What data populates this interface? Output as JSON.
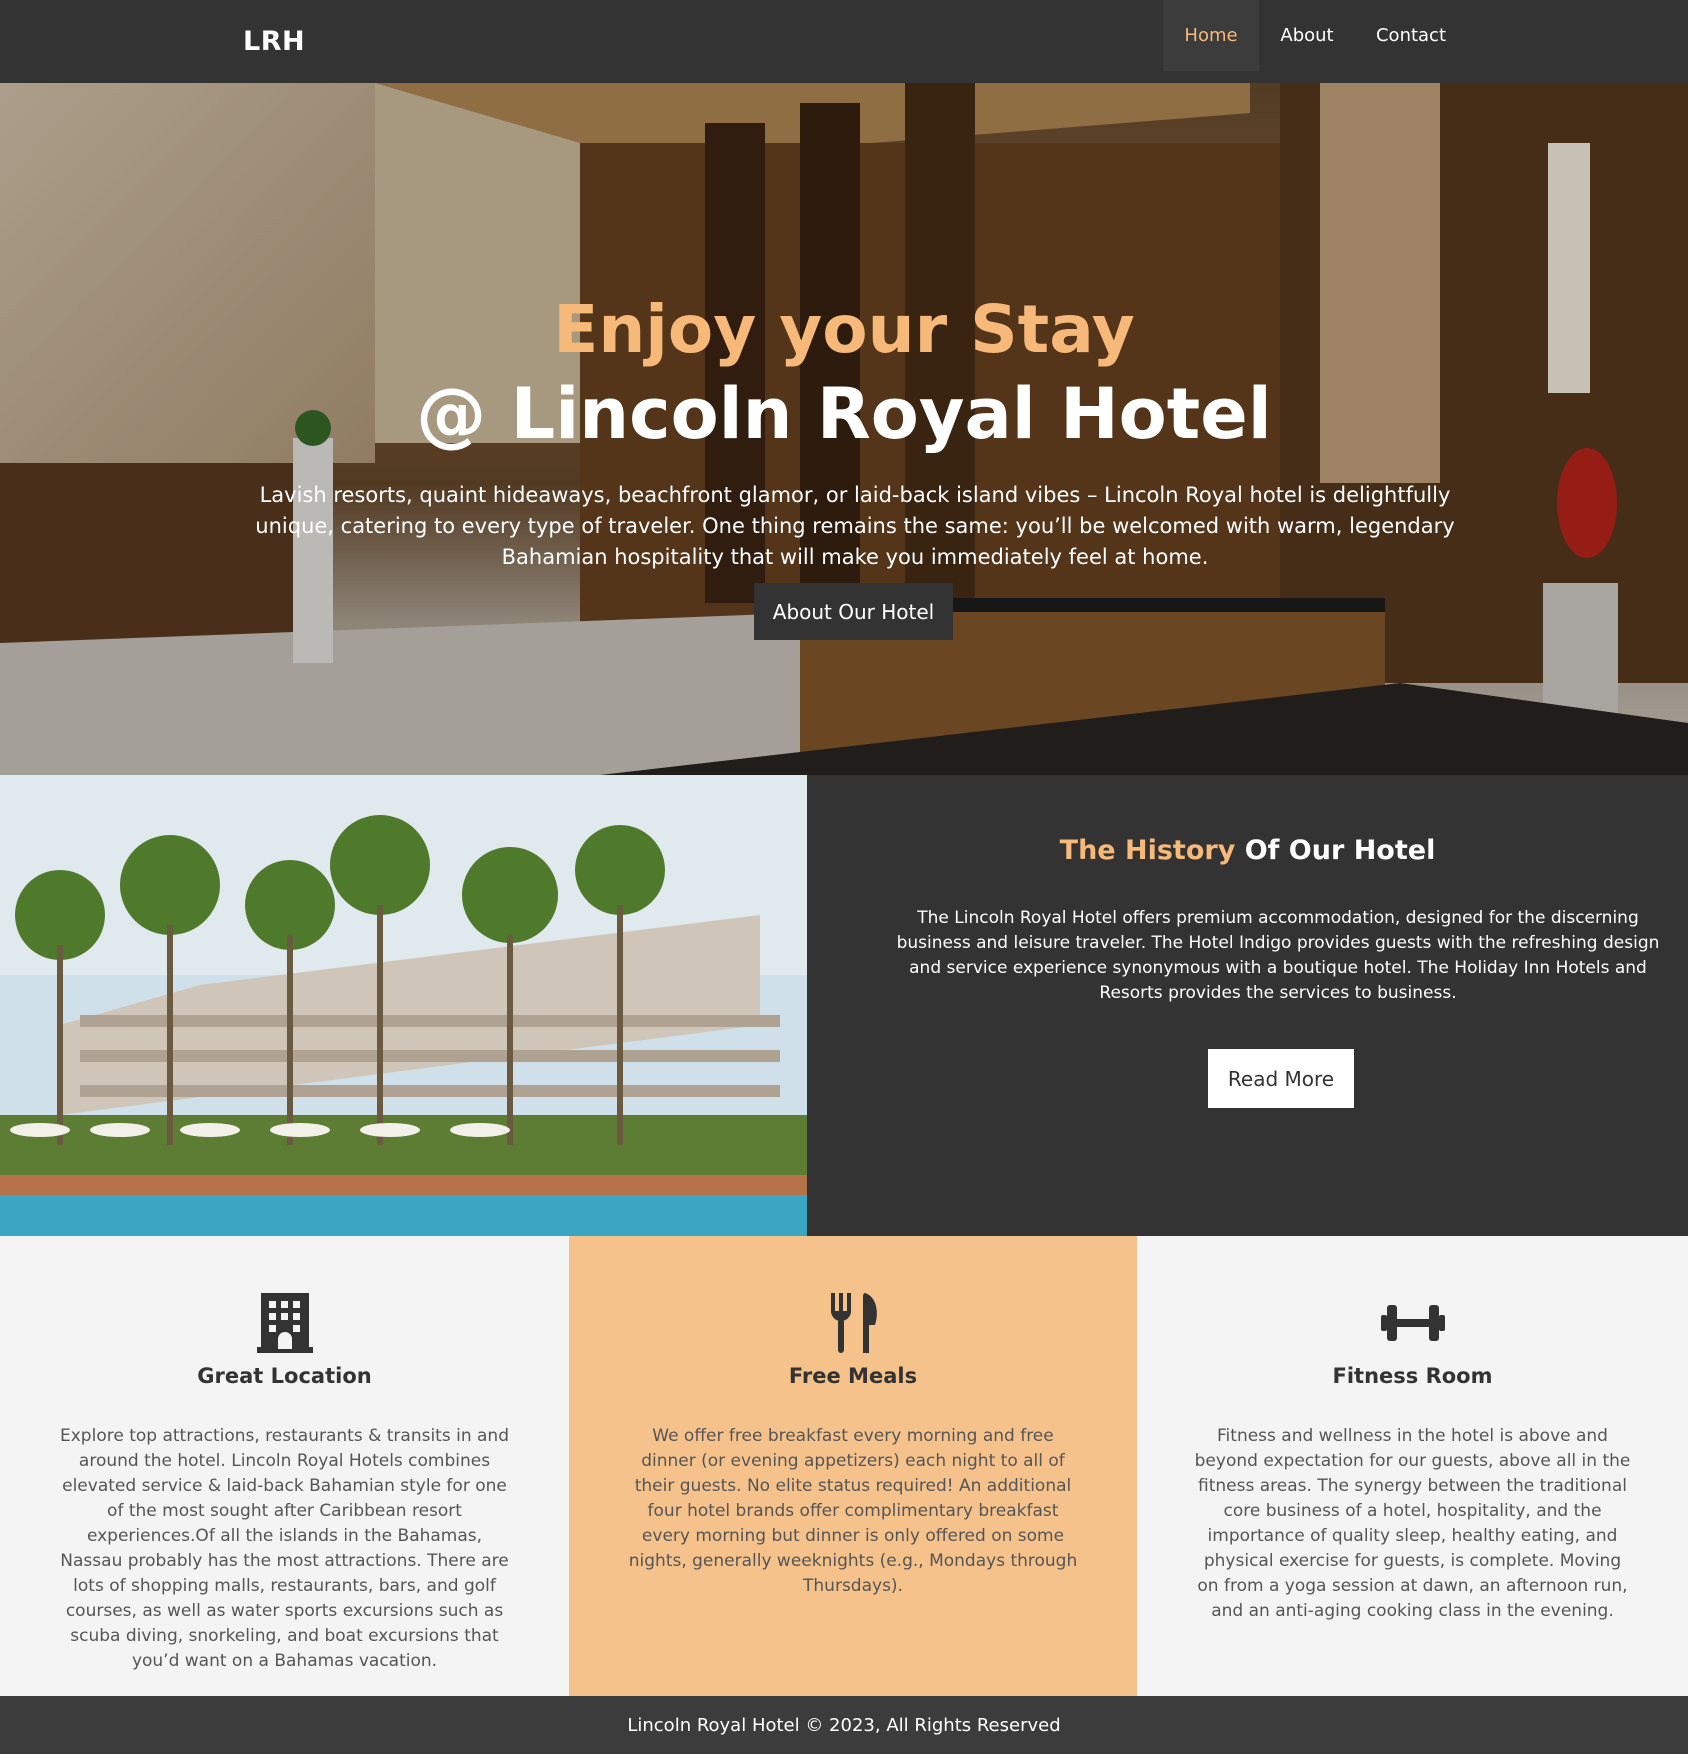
{
  "nav": {
    "logo": "LRH",
    "links": [
      {
        "label": "Home",
        "active": true
      },
      {
        "label": "About"
      },
      {
        "label": "Contact"
      }
    ]
  },
  "hero": {
    "title_line1": "Enjoy your Stay",
    "title_line2": "@ Lincoln Royal Hotel",
    "text": "Lavish resorts, quaint hideaways, beachfront glamor, or laid-back island vibes – Lincoln Royal hotel is delightfully unique, catering to every type of traveler. One thing remains the same: you’ll be welcomed with warm, legendary Bahamian hospitality that will make you immediately feel at home.",
    "button": "About Our Hotel"
  },
  "history": {
    "title_accent": "The History",
    "title_rest": " Of Our Hotel",
    "text": "The Lincoln Royal Hotel offers premium accommodation, designed for the discerning business and leisure traveler. The Hotel Indigo provides guests with the refreshing design and service experience synonymous with a boutique hotel. The Holiday Inn Hotels and Resorts provides the services to business.",
    "button": "Read More"
  },
  "features": [
    {
      "icon": "building-icon",
      "title": "Great Location",
      "text": "Explore top attractions, restaurants & transits in and around the hotel. Lincoln Royal Hotels combines elevated service & laid-back Bahamian style for one of the most sought after Caribbean resort experiences.Of all the islands in the Bahamas, Nassau probably has the most attractions. There are lots of shopping malls, restaurants, bars, and golf courses, as well as water sports excursions such as scuba diving, snorkeling, and boat excursions that you’d want on a Bahamas vacation."
    },
    {
      "icon": "utensils-icon",
      "title": "Free Meals",
      "text": "We offer free breakfast every morning and free dinner (or evening appetizers) each night to all of their guests. No elite status required! An additional four hotel brands offer complimentary breakfast every morning but dinner is only offered on some nights, generally weeknights (e.g., Mondays through Thursdays)."
    },
    {
      "icon": "dumbbell-icon",
      "title": "Fitness Room",
      "text": "Fitness and wellness in the hotel is above and beyond expectation for our guests, above all in the fitness areas. The synergy between the traditional core business of a hotel, hospitality, and the importance of quality sleep, healthy eating, and physical exercise for guests, is complete. Moving on from a yoga session at dawn, an afternoon run, and an anti-aging cooking class in the evening."
    }
  ],
  "footer": {
    "text": "Lincoln Royal Hotel © 2023, All Rights Reserved"
  },
  "colors": {
    "accent": "#f6b979",
    "dark": "#333333",
    "feature_highlight": "#f6c28c",
    "light": "#f4f4f4"
  }
}
